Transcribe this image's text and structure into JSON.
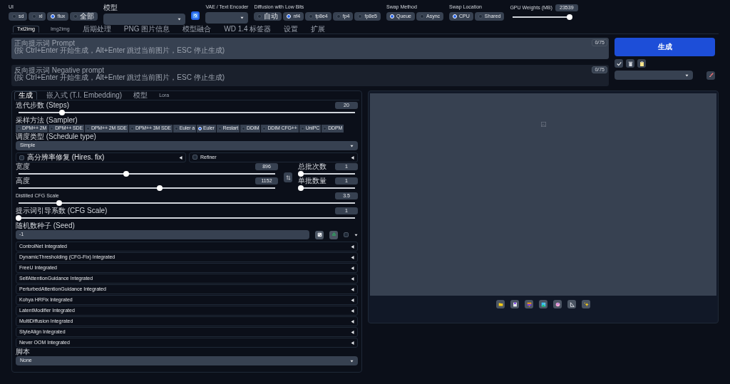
{
  "top_bar": {
    "ui": {
      "label": "UI",
      "options": [
        {
          "label": "sd",
          "selected": false
        },
        {
          "label": "xl",
          "selected": false
        },
        {
          "label": "flux",
          "selected": true
        },
        {
          "label": "全部",
          "selected": false
        }
      ]
    },
    "model": {
      "label": "模型"
    },
    "vae": {
      "label": "VAE / Text Encoder"
    },
    "low_bits": {
      "label": "Diffusion with Low Bits",
      "options": [
        {
          "label": "自动",
          "selected": false
        },
        {
          "label": "nf4",
          "selected": true
        },
        {
          "label": "fp8e4",
          "selected": false
        },
        {
          "label": "fp4",
          "selected": false
        },
        {
          "label": "fp8e5",
          "selected": false
        }
      ]
    },
    "swap_method": {
      "label": "Swap Method",
      "options": [
        {
          "label": "Queue",
          "selected": true
        },
        {
          "label": "Async",
          "selected": false
        }
      ]
    },
    "swap_location": {
      "label": "Swap Location",
      "options": [
        {
          "label": "CPU",
          "selected": true
        },
        {
          "label": "Shared",
          "selected": false
        }
      ]
    },
    "gpu_weights": {
      "label": "GPU Weights (MB)",
      "value": "23539",
      "level": 0.97
    }
  },
  "tabs": [
    {
      "label": "Txt2img",
      "selected": true
    },
    {
      "label": "Img2img",
      "selected": false
    },
    {
      "label": "后期处理",
      "selected": false
    },
    {
      "label": "PNG 图片信息",
      "selected": false
    },
    {
      "label": "模型融合",
      "selected": false
    },
    {
      "label": "WD 1.4 标签器",
      "selected": false
    },
    {
      "label": "设置",
      "selected": false
    },
    {
      "label": "扩展",
      "selected": false
    }
  ],
  "prompt": {
    "placeholder": "正向提示词 Prompt\n(按 Ctrl+Enter 开始生成，Alt+Enter 跳过当前图片，ESC 停止生成)",
    "counter": "0/75"
  },
  "negative_prompt": {
    "placeholder": "反向提示词 Negative prompt\n(按 Ctrl+Enter 开始生成，Alt+Enter 跳过当前图片，ESC 停止生成)",
    "counter": "0/75"
  },
  "generate_button": "生成",
  "sub_tabs": [
    {
      "label": "生成",
      "selected": true
    },
    {
      "label": "嵌入式 (T.I. Embedding)",
      "selected": false
    },
    {
      "label": "模型",
      "selected": false
    },
    {
      "label": "Lora",
      "selected": false
    }
  ],
  "steps": {
    "label": "迭代步数 (Steps)",
    "value": "20",
    "level": 0.13
  },
  "sampler": {
    "label": "采样方法 (Sampler)",
    "options": [
      {
        "label": "DPM++ 2M",
        "selected": false
      },
      {
        "label": "DPM++ SDE",
        "selected": false
      },
      {
        "label": "DPM++ 2M SDE",
        "selected": false
      },
      {
        "label": "DPM++ 3M SDE",
        "selected": false
      },
      {
        "label": "Euler a",
        "selected": false
      },
      {
        "label": "Euler",
        "selected": true
      },
      {
        "label": "Restart",
        "selected": false
      },
      {
        "label": "DDIM",
        "selected": false
      },
      {
        "label": "DDIM CFG++",
        "selected": false
      },
      {
        "label": "UniPC",
        "selected": false
      },
      {
        "label": "DDPM",
        "selected": false
      }
    ]
  },
  "schedule": {
    "label": "调度类型 (Schedule type)",
    "value": "Simple"
  },
  "hires": {
    "label": "高分辨率修复 (Hires. fix)",
    "checked": false,
    "expanded": false
  },
  "refiner": {
    "label": "Refiner",
    "checked": false,
    "expanded": false
  },
  "width": {
    "label": "宽度",
    "value": "896",
    "level": 0.42
  },
  "height": {
    "label": "高度",
    "value": "1152",
    "level": 0.55
  },
  "batch_count": {
    "label": "总批次数",
    "value": "1",
    "level": 0
  },
  "batch_size": {
    "label": "单批数量",
    "value": "1",
    "level": 0
  },
  "distilled_cfg": {
    "label": "Distilled CFG Scale",
    "value": "3.5",
    "level": 0.12
  },
  "cfg": {
    "label": "提示词引导系数 (CFG Scale)",
    "value": "1",
    "level": 0
  },
  "seed": {
    "label": "随机数种子 (Seed)",
    "value": "-1",
    "extra_checked": false
  },
  "accordions": [
    {
      "label": "ControlNet Integrated",
      "expanded": false
    },
    {
      "label": "DynamicThresholding (CFG-Fix) Integrated",
      "expanded": false
    },
    {
      "label": "FreeU Integrated",
      "expanded": false
    },
    {
      "label": "SelfAttentionGuidance Integrated",
      "expanded": false
    },
    {
      "label": "PerturbedAttentionGuidance Integrated",
      "expanded": false
    },
    {
      "label": "Kohya HRFix Integrated",
      "expanded": false
    },
    {
      "label": "LatentModifier Integrated",
      "expanded": false
    },
    {
      "label": "MultiDiffusion Integrated",
      "expanded": false
    },
    {
      "label": "StyleAlign Integrated",
      "expanded": false
    },
    {
      "label": "Never OOM Integrated",
      "expanded": false
    }
  ],
  "script": {
    "label": "脚本",
    "value": "None"
  }
}
